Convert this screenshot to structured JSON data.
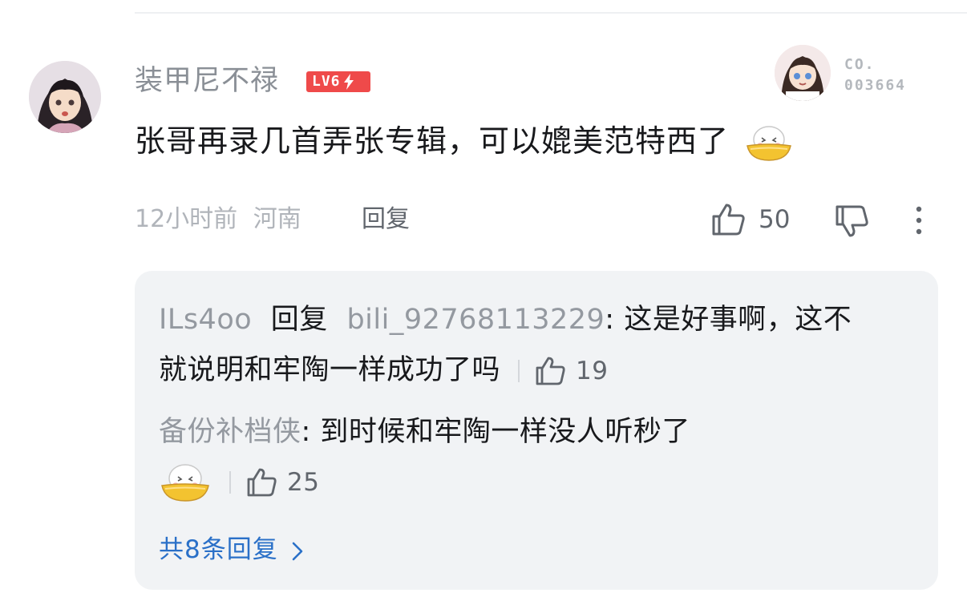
{
  "comment": {
    "username": "装甲尼不禄",
    "level_badge": "LV6",
    "fan_badge": {
      "label": "CO.",
      "number": "003664"
    },
    "text": "张哥再录几首弄张专辑，可以媲美范特西了",
    "emoji_icon": "bowl-smile-emoji",
    "time": "12小时前",
    "location": "河南",
    "reply_label": "回复",
    "like_count": "50"
  },
  "replies": {
    "items": [
      {
        "user": "ILs4oo",
        "reply_word": "回复",
        "target": "bili_92768113229",
        "text_line1": ": 这是好事啊，这不",
        "text_line2": "就说明和牢陶一样成功了吗",
        "likes": "19"
      },
      {
        "user": "备份补档侠",
        "text": ": 到时候和牢陶一样没人听秒了",
        "emoji_icon": "bowl-smile-emoji",
        "likes": "25"
      }
    ],
    "see_more": "共8条回复"
  },
  "colors": {
    "accent_blue": "#2a70c8",
    "level_red": "#ef4a4a",
    "text_primary": "#18191c",
    "text_muted": "#9499a0"
  }
}
